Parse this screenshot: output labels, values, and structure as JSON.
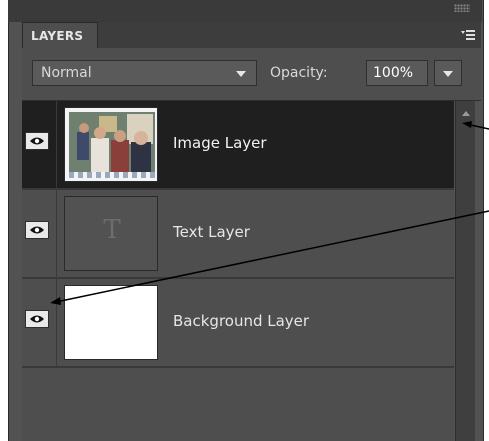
{
  "panel": {
    "title": "LAYERS",
    "menu_icon": "panel-menu-icon"
  },
  "controls": {
    "blend_mode": "Normal",
    "opacity_label": "Opacity:",
    "opacity_value": "100%"
  },
  "layers": [
    {
      "name": "Image Layer",
      "visible": true,
      "selected": true,
      "thumbnail": "photo-thumbnail"
    },
    {
      "name": "Text Layer",
      "visible": true,
      "selected": false,
      "thumbnail": "text-layer-thumbnail",
      "thumb_glyph": "T"
    },
    {
      "name": "Background Layer",
      "visible": true,
      "selected": false,
      "thumbnail": "white-thumbnail"
    }
  ],
  "colors": {
    "panel_bg": "#4e4e4e",
    "selected_row": "#1f1f1f",
    "text": "#e6e6e6"
  }
}
